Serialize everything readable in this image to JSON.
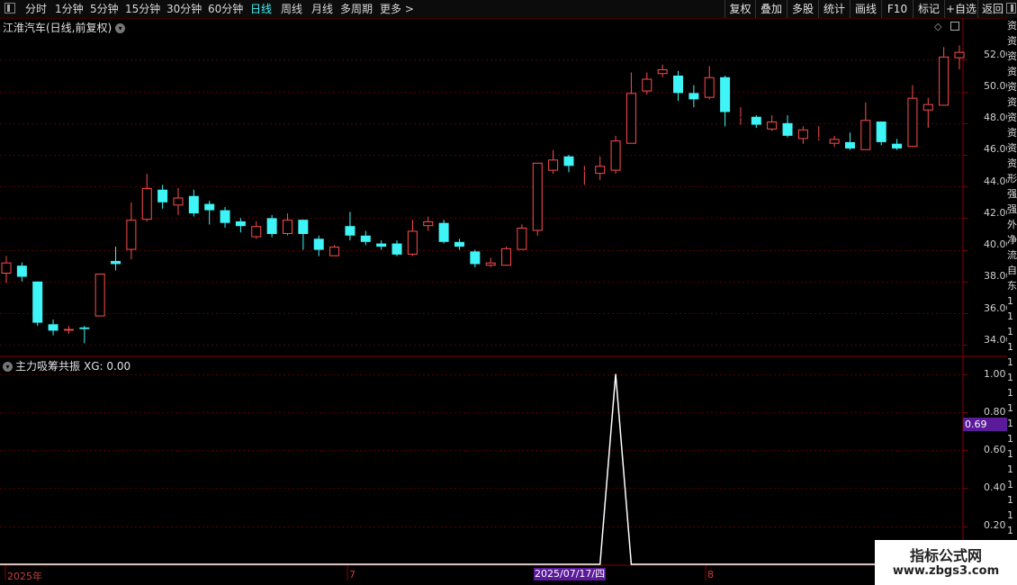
{
  "toolbar": {
    "periods": [
      "分时",
      "1分钟",
      "5分钟",
      "15分钟",
      "30分钟",
      "60分钟",
      "日线",
      "周线",
      "月线",
      "多周期",
      "更多 >"
    ],
    "active_period": "日线",
    "right_buttons": [
      "复权",
      "叠加",
      "多股",
      "统计",
      "画线",
      "F10",
      "标记",
      "+自选",
      "返回"
    ]
  },
  "main": {
    "title": "江淮汽车(日线,前复权)",
    "y_ticks": [
      "52.00",
      "50.00",
      "48.00",
      "46.00",
      "44.00",
      "42.00",
      "40.00",
      "38.00",
      "36.00",
      "34.00"
    ]
  },
  "indicator": {
    "title": "主力吸筹共振",
    "xg_label": "XG: 0.00",
    "y_ticks": [
      "1.00",
      "0.80",
      "0.60",
      "0.40",
      "0.20"
    ],
    "current_value": "0.69"
  },
  "x_axis": {
    "labels": [
      "2025年",
      "7",
      "8"
    ],
    "cursor_date": "2025/07/17/四"
  },
  "right_strip": [
    "资",
    "资",
    "资",
    "资",
    "资",
    "资",
    "资",
    "资",
    "资",
    "资",
    "形",
    "强",
    "强",
    "外",
    "净",
    "流",
    "自",
    "东",
    "1",
    "1",
    "1",
    "1",
    "1",
    "1",
    "1",
    "1",
    "1",
    "1",
    "1",
    "1",
    "1",
    "1",
    "1",
    "1",
    "1"
  ],
  "watermark": {
    "line1": "指标公式网",
    "line2": "www.zbgs3.com"
  },
  "colors": {
    "up": "#ff4d4d",
    "down": "#3ff4f6",
    "grid": "#5a0000",
    "signal": "#ffffff",
    "active": "#3ff4f6"
  },
  "chart_data": {
    "type": "candlestick",
    "y_range": [
      33.5,
      53.5
    ],
    "candles": [
      {
        "o": 38.5,
        "c": 39.2,
        "h": 39.6,
        "l": 37.9
      },
      {
        "o": 39.0,
        "c": 38.3,
        "h": 39.2,
        "l": 38.0
      },
      {
        "o": 38.0,
        "c": 35.4,
        "h": 38.0,
        "l": 35.2
      },
      {
        "o": 35.3,
        "c": 34.9,
        "h": 35.6,
        "l": 34.6
      },
      {
        "o": 34.9,
        "c": 35.0,
        "h": 35.2,
        "l": 34.7
      },
      {
        "o": 35.1,
        "c": 35.0,
        "h": 35.2,
        "l": 34.1
      },
      {
        "o": 35.8,
        "c": 38.5,
        "h": 38.5,
        "l": 35.8
      },
      {
        "o": 39.3,
        "c": 39.1,
        "h": 40.2,
        "l": 38.7
      },
      {
        "o": 40.0,
        "c": 41.9,
        "h": 43.0,
        "l": 39.4
      },
      {
        "o": 41.9,
        "c": 43.9,
        "h": 44.8,
        "l": 41.8
      },
      {
        "o": 43.8,
        "c": 43.0,
        "h": 44.1,
        "l": 42.6
      },
      {
        "o": 42.8,
        "c": 43.3,
        "h": 43.9,
        "l": 42.2
      },
      {
        "o": 43.4,
        "c": 42.3,
        "h": 43.8,
        "l": 42.1
      },
      {
        "o": 42.9,
        "c": 42.5,
        "h": 43.1,
        "l": 41.6
      },
      {
        "o": 42.5,
        "c": 41.7,
        "h": 42.7,
        "l": 41.4
      },
      {
        "o": 41.8,
        "c": 41.5,
        "h": 42.0,
        "l": 41.1
      },
      {
        "o": 40.8,
        "c": 41.5,
        "h": 41.8,
        "l": 40.7
      },
      {
        "o": 42.0,
        "c": 41.0,
        "h": 42.2,
        "l": 40.8
      },
      {
        "o": 41.0,
        "c": 41.9,
        "h": 42.3,
        "l": 40.9
      },
      {
        "o": 41.9,
        "c": 41.0,
        "h": 41.9,
        "l": 40.0
      },
      {
        "o": 40.7,
        "c": 40.0,
        "h": 40.9,
        "l": 39.6
      },
      {
        "o": 39.6,
        "c": 40.2,
        "h": 40.3,
        "l": 39.6
      },
      {
        "o": 41.5,
        "c": 40.9,
        "h": 42.4,
        "l": 40.6
      },
      {
        "o": 40.9,
        "c": 40.5,
        "h": 41.2,
        "l": 40.3
      },
      {
        "o": 40.4,
        "c": 40.2,
        "h": 40.6,
        "l": 40.0
      },
      {
        "o": 40.4,
        "c": 39.7,
        "h": 40.6,
        "l": 39.6
      },
      {
        "o": 39.7,
        "c": 41.2,
        "h": 41.9,
        "l": 39.6
      },
      {
        "o": 41.5,
        "c": 41.8,
        "h": 42.1,
        "l": 41.2
      },
      {
        "o": 41.7,
        "c": 40.5,
        "h": 41.9,
        "l": 40.4
      },
      {
        "o": 40.5,
        "c": 40.2,
        "h": 40.7,
        "l": 40.0
      },
      {
        "o": 39.9,
        "c": 39.1,
        "h": 40.0,
        "l": 38.9
      },
      {
        "o": 39.0,
        "c": 39.2,
        "h": 39.5,
        "l": 38.9
      },
      {
        "o": 39.0,
        "c": 40.1,
        "h": 40.2,
        "l": 39.0
      },
      {
        "o": 40.0,
        "c": 41.4,
        "h": 41.6,
        "l": 40.0
      },
      {
        "o": 41.2,
        "c": 45.5,
        "h": 45.5,
        "l": 40.9
      },
      {
        "o": 45.0,
        "c": 45.7,
        "h": 46.3,
        "l": 44.8
      },
      {
        "o": 45.9,
        "c": 45.3,
        "h": 46.0,
        "l": 44.9
      },
      {
        "o": 45.0,
        "c": 45.0,
        "h": 45.3,
        "l": 44.1
      },
      {
        "o": 44.8,
        "c": 45.3,
        "h": 45.9,
        "l": 44.4
      },
      {
        "o": 45.0,
        "c": 46.9,
        "h": 47.2,
        "l": 44.8
      },
      {
        "o": 46.7,
        "c": 49.9,
        "h": 51.2,
        "l": 46.7
      },
      {
        "o": 50.0,
        "c": 50.8,
        "h": 51.2,
        "l": 49.8
      },
      {
        "o": 51.1,
        "c": 51.4,
        "h": 51.7,
        "l": 50.9
      },
      {
        "o": 51.0,
        "c": 49.9,
        "h": 51.3,
        "l": 49.4
      },
      {
        "o": 49.9,
        "c": 49.5,
        "h": 50.4,
        "l": 49.0
      },
      {
        "o": 49.6,
        "c": 50.9,
        "h": 51.6,
        "l": 49.5
      },
      {
        "o": 50.9,
        "c": 48.7,
        "h": 51.0,
        "l": 47.8
      },
      {
        "o": 48.4,
        "c": 48.4,
        "h": 49.0,
        "l": 47.9
      },
      {
        "o": 48.4,
        "c": 47.9,
        "h": 48.5,
        "l": 47.7
      },
      {
        "o": 47.6,
        "c": 48.1,
        "h": 48.5,
        "l": 47.5
      },
      {
        "o": 48.0,
        "c": 47.2,
        "h": 48.5,
        "l": 47.1
      },
      {
        "o": 47.0,
        "c": 47.6,
        "h": 47.8,
        "l": 46.7
      },
      {
        "o": 47.1,
        "c": 47.1,
        "h": 47.8,
        "l": 46.9
      },
      {
        "o": 46.7,
        "c": 47.0,
        "h": 47.2,
        "l": 46.5
      },
      {
        "o": 46.8,
        "c": 46.4,
        "h": 47.4,
        "l": 46.3
      },
      {
        "o": 46.3,
        "c": 48.2,
        "h": 49.3,
        "l": 46.3
      },
      {
        "o": 48.1,
        "c": 46.8,
        "h": 48.1,
        "l": 46.6
      },
      {
        "o": 46.7,
        "c": 46.4,
        "h": 47.0,
        "l": 46.3
      },
      {
        "o": 46.5,
        "c": 49.6,
        "h": 50.4,
        "l": 46.5
      },
      {
        "o": 48.8,
        "c": 49.2,
        "h": 49.6,
        "l": 47.7
      },
      {
        "o": 49.1,
        "c": 52.2,
        "h": 52.8,
        "l": 49.1
      },
      {
        "o": 52.1,
        "c": 52.5,
        "h": 52.9,
        "l": 51.4
      }
    ],
    "indicator_series": {
      "name": "主力吸筹共振",
      "y_range": [
        0,
        1.05
      ],
      "values": [
        0,
        0,
        0,
        0,
        0,
        0,
        0,
        0,
        0,
        0,
        0,
        0,
        0,
        0,
        0,
        0,
        0,
        0,
        0,
        0,
        0,
        0,
        0,
        0,
        0,
        0,
        0,
        0,
        0,
        0,
        0,
        0,
        0,
        0,
        0,
        0,
        0,
        0,
        0,
        1,
        0,
        0,
        0,
        0,
        0,
        0,
        0,
        0,
        0,
        0,
        0,
        0,
        0,
        0,
        0,
        0,
        0,
        0,
        0,
        0,
        0,
        0
      ]
    }
  }
}
